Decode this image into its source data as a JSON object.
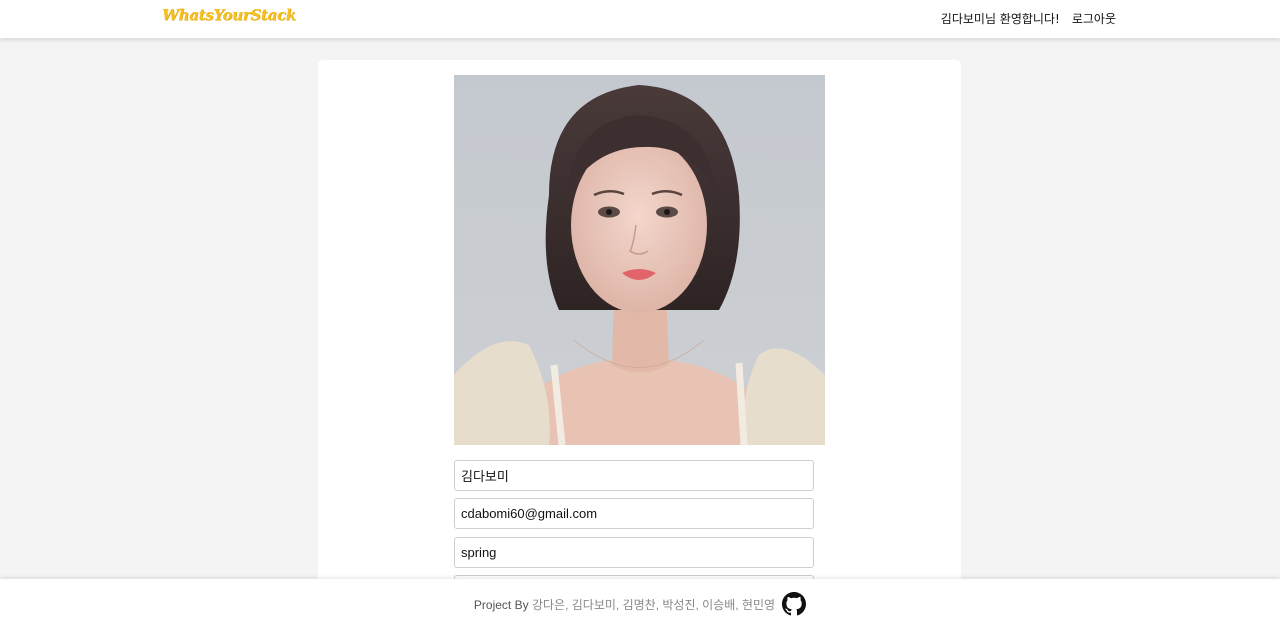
{
  "header": {
    "logo": "WhatsYourStack",
    "welcome": "김다보미님 환영합니다!",
    "logout": "로그아웃"
  },
  "profile": {
    "name": "김다보미",
    "email": "cdabomi60@gmail.com",
    "stack": "spring"
  },
  "footer": {
    "prefix": "Project By ",
    "names": "강다은, 김다보미, 김명찬, 박성진, 이승배, 현민영",
    "github_icon": "github-icon"
  },
  "colors": {
    "logo": "#f5c020",
    "background": "#f4f4f4"
  }
}
